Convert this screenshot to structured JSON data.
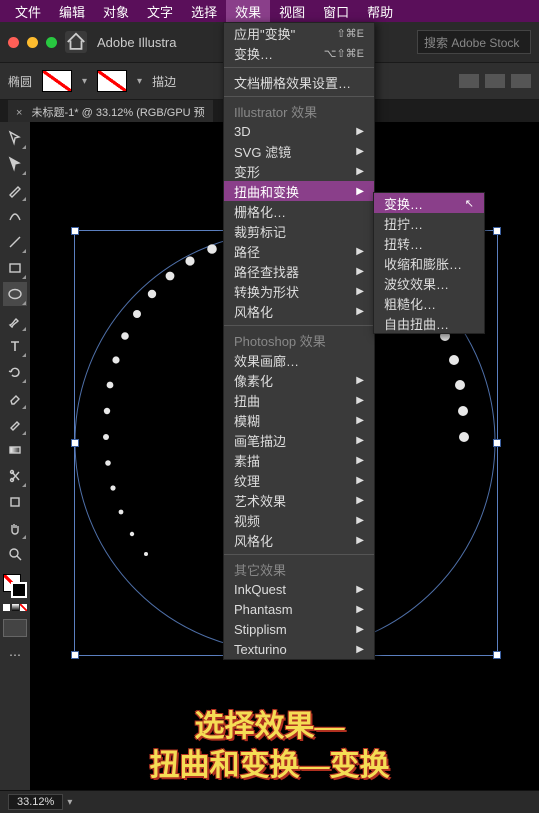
{
  "menubar": {
    "items": [
      "文件",
      "编辑",
      "对象",
      "文字",
      "选择",
      "效果",
      "视图",
      "窗口",
      "帮助"
    ],
    "open_index": 5
  },
  "toolbar1": {
    "appname": "Adobe Illustra",
    "search_placeholder": "搜索 Adobe Stock"
  },
  "toolbar2": {
    "label_shape": "椭圆",
    "label_stroke": "描边"
  },
  "tab": {
    "close": "×",
    "title": "未标题-1* @ 33.12% (RGB/GPU 预"
  },
  "status": {
    "zoom": "33.12%"
  },
  "menu_effect": {
    "g1": [
      {
        "label": "应用\"变换\"",
        "shortcut": "⇧⌘E"
      },
      {
        "label": "变换…",
        "shortcut": "⌥⇧⌘E"
      }
    ],
    "doc_raster": "文档栅格效果设置…",
    "head_ai": "Illustrator 效果",
    "ai": [
      {
        "label": "3D",
        "sub": true
      },
      {
        "label": "SVG 滤镜",
        "sub": true
      },
      {
        "label": "变形",
        "sub": true
      },
      {
        "label": "扭曲和变换",
        "sub": true,
        "hl": true
      },
      {
        "label": "栅格化…"
      },
      {
        "label": "裁剪标记"
      },
      {
        "label": "路径",
        "sub": true
      },
      {
        "label": "路径查找器",
        "sub": true
      },
      {
        "label": "转换为形状",
        "sub": true
      },
      {
        "label": "风格化",
        "sub": true
      }
    ],
    "head_ps": "Photoshop 效果",
    "ps": [
      "效果画廊…",
      "像素化",
      "扭曲",
      "模糊",
      "画笔描边",
      "素描",
      "纹理",
      "艺术效果",
      "视频",
      "风格化"
    ],
    "head_other": "其它效果",
    "other": [
      "InkQuest",
      "Phantasm",
      "Stipplism",
      "Texturino"
    ]
  },
  "submenu_distort": [
    {
      "label": "变换…",
      "hl": true
    },
    {
      "label": "扭拧…"
    },
    {
      "label": "扭转…"
    },
    {
      "label": "收缩和膨胀…"
    },
    {
      "label": "波纹效果…"
    },
    {
      "label": "粗糙化…"
    },
    {
      "label": "自由扭曲…"
    }
  ],
  "tools": [
    "selection",
    "direct",
    "pen",
    "curvature",
    "line",
    "rect",
    "ellipse",
    "brush",
    "type",
    "rotate",
    "eraser",
    "eyedropper",
    "gradient",
    "scissors",
    "artboard",
    "zoom",
    "hand"
  ],
  "annotation": {
    "line1": "选择效果—",
    "line2": "扭曲和变换—变换"
  },
  "chart_data": {
    "type": "other",
    "description": "Illustrator canvas showing a dotted ellipse path with selection bounding box; Effect > Distort & Transform submenu open with Transform highlighted"
  }
}
